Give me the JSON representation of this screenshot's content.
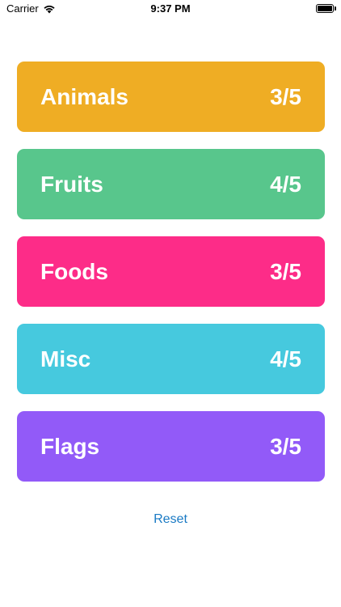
{
  "status_bar": {
    "carrier": "Carrier",
    "time": "9:37 PM"
  },
  "categories": [
    {
      "name": "Animals",
      "score": "3/5",
      "color": "#efad24"
    },
    {
      "name": "Fruits",
      "score": "4/5",
      "color": "#58c68c"
    },
    {
      "name": "Foods",
      "score": "3/5",
      "color": "#fd2c88"
    },
    {
      "name": "Misc",
      "score": "4/5",
      "color": "#46c9de"
    },
    {
      "name": "Flags",
      "score": "3/5",
      "color": "#925af8"
    }
  ],
  "reset_label": "Reset",
  "colors": {
    "link": "#1a7ac4",
    "background": "#ffffff"
  }
}
